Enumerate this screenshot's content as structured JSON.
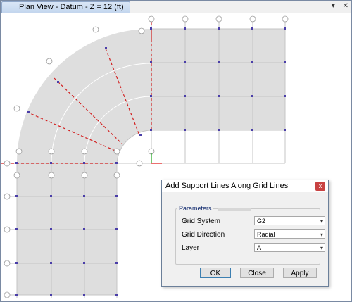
{
  "window": {
    "tab_title": "Plan View - Datum - Z = 12 (ft)",
    "pin_icon": "pin-icon",
    "close_icon": "close-icon"
  },
  "plan": {
    "grid_labels_top": [
      "B",
      "B",
      "C",
      "D",
      "E",
      "F"
    ],
    "grid_labels_left": [
      "1",
      "2",
      "3",
      "4",
      "5"
    ],
    "radial_labels": [
      "A",
      "B",
      "C",
      "D",
      "2",
      "3",
      "4"
    ],
    "colors": {
      "slab": "#dedede",
      "grid": "#cfcfcf",
      "support": "#d21f1f",
      "node": "#4a3ea8"
    }
  },
  "dialog": {
    "title": "Add Support Lines Along Grid Lines",
    "group_label": "Parameters",
    "fields": [
      {
        "label": "Grid System",
        "value": "G2"
      },
      {
        "label": "Grid Direction",
        "value": "Radial"
      },
      {
        "label": "Layer",
        "value": "A"
      }
    ],
    "buttons": {
      "ok": "OK",
      "close": "Close",
      "apply": "Apply"
    },
    "close_x": "x"
  }
}
